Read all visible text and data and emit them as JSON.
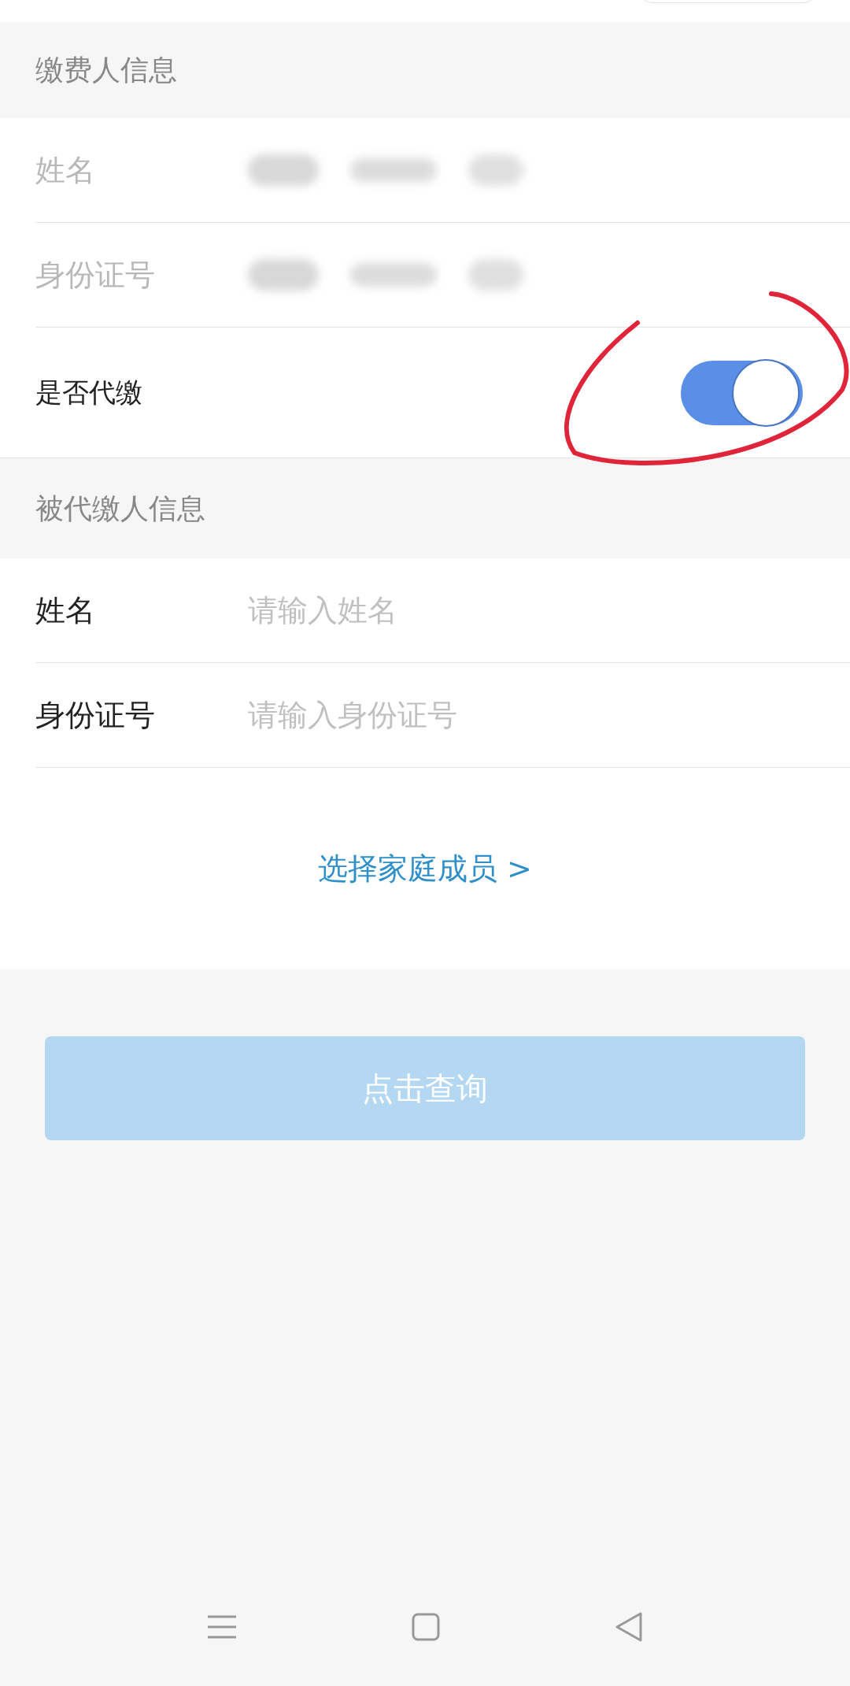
{
  "payer_section": {
    "title": "缴费人信息",
    "fields": [
      {
        "label": "姓名",
        "disabled": true
      },
      {
        "label": "身份证号",
        "disabled": true
      }
    ],
    "proxy_toggle": {
      "label": "是否代缴",
      "on": true
    }
  },
  "payee_section": {
    "title": "被代缴人信息",
    "fields": [
      {
        "label": "姓名",
        "placeholder": "请输入姓名",
        "disabled": false
      },
      {
        "label": "身份证号",
        "placeholder": "请输入身份证号",
        "disabled": false
      }
    ]
  },
  "family_link": "选择家庭成员 >",
  "query_button": {
    "label": "点击查询",
    "disabled": true
  }
}
